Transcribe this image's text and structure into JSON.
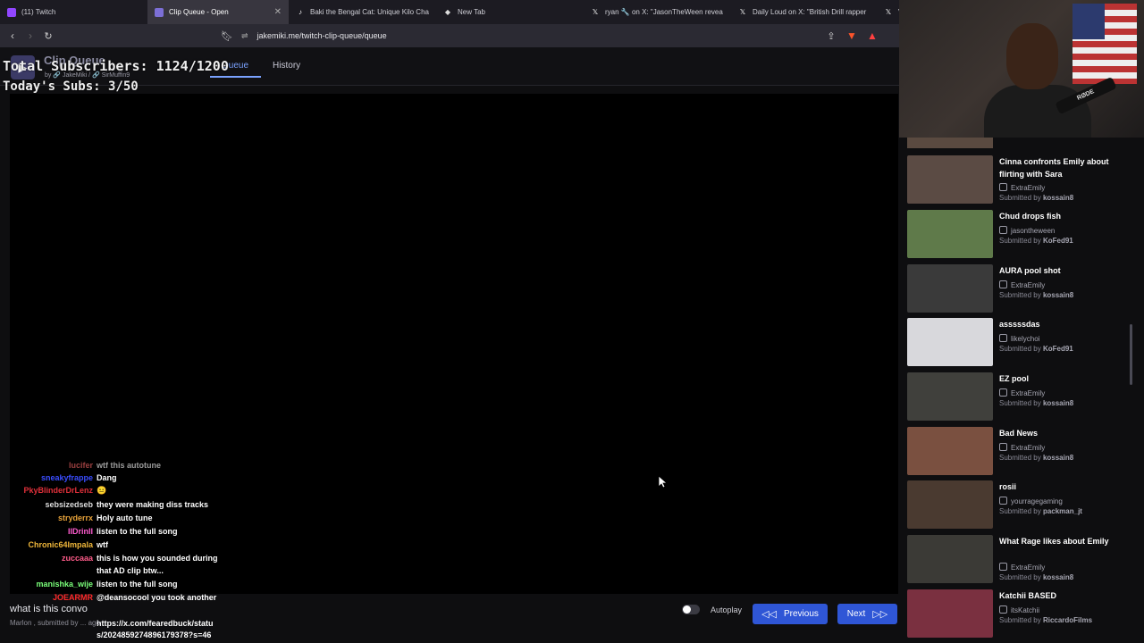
{
  "browser": {
    "tabs": [
      {
        "label": "(11) Twitch",
        "icon": "twitch-icon",
        "color": "#9146ff"
      },
      {
        "label": "Clip Queue - Open",
        "icon": "clipqueue-icon",
        "color": "#7c6fd6"
      },
      {
        "label": "Baki the Bengal Cat: Unique Kilo Cha",
        "icon": "tiktok-icon",
        "color": "#ffffff"
      },
      {
        "label": "New Tab",
        "icon": "brave-icon",
        "color": "#dddddd"
      },
      {
        "label": "ryan 🔧 on X: \"JasonTheWeen revea",
        "icon": "x-icon",
        "color": "#ffffff"
      },
      {
        "label": "Daily Loud on X: \"British Drill rapper",
        "icon": "x-icon",
        "color": "#ffffff"
      },
      {
        "label": "V",
        "icon": "x-icon",
        "color": "#ffffff"
      }
    ],
    "url": "jakemiki.me/twitch-clip-queue/queue"
  },
  "app": {
    "title": "Clip Queue",
    "by": "by 🔗 JakeMiki / 🔗 SirMuffin9",
    "nav": {
      "queue": "Queue",
      "history": "History"
    }
  },
  "overlay": {
    "total_subs": "Total Subscribers: 1124/1200",
    "today_subs": "Today's Subs: 3/50"
  },
  "chat": [
    {
      "user": "lucifer",
      "msg": "wtf this autotune",
      "color": "#ff6a6a"
    },
    {
      "user": "sneakyfrappe",
      "msg": "Dang",
      "color": "#3a4dff"
    },
    {
      "user": "PkyBlinderDrLenz",
      "msg": "😐",
      "color": "#e0303a"
    },
    {
      "user": "sebsizedseb",
      "msg": "they were making diss tracks",
      "color": "#dddddd"
    },
    {
      "user": "stryderrx",
      "msg": "Holy auto tune",
      "color": "#e8a33a"
    },
    {
      "user": "IIDrinII",
      "msg": "listen to the full song",
      "color": "#ff5ccf"
    },
    {
      "user": "Chronic64Impala",
      "msg": "wtf",
      "color": "#f0b73a"
    },
    {
      "user": "zuccaaa",
      "msg": "this is how you sounded during",
      "color": "#ff5c8a"
    },
    {
      "user": "",
      "msg": "that AD clip btw...",
      "color": "#ffffff"
    },
    {
      "user": "manishka_wije",
      "msg": "listen to the full song",
      "color": "#7aff7a"
    },
    {
      "user": "JOEARMR",
      "msg": "@deansocool you took another",
      "color": "#ff2a2a"
    },
    {
      "user": "",
      "msg": "https://x.com/fearedbuck/statu",
      "color": "#ffffff"
    },
    {
      "user": "",
      "msg": "s/2024859274896179378?s=46",
      "color": "#ffffff"
    }
  ],
  "current_clip": {
    "title": "what is this convo",
    "sub": "Marlon , submitted by ... ago"
  },
  "controls": {
    "autoplay": "Autoplay",
    "previous": "Previous",
    "next": "Next"
  },
  "queue": [
    {
      "title": "Cinna confronts Emily about flirting with Sara",
      "channel": "ExtraEmily",
      "submitter": "kossain8",
      "thumb": "#5b4b44"
    },
    {
      "title": "Chud drops fish",
      "channel": "jasontheween",
      "submitter": "KoFed91",
      "thumb": "#5f7a4a"
    },
    {
      "title": "AURA pool shot",
      "channel": "ExtraEmily",
      "submitter": "kossain8",
      "thumb": "#3a3a3a"
    },
    {
      "title": "asssssdas",
      "channel": "likelychoi",
      "submitter": "KoFed91",
      "thumb": "#d8d8dc"
    },
    {
      "title": "EZ pool",
      "channel": "ExtraEmily",
      "submitter": "kossain8",
      "thumb": "#40403c"
    },
    {
      "title": "Bad News",
      "channel": "ExtraEmily",
      "submitter": "kossain8",
      "thumb": "#7a5040"
    },
    {
      "title": "rosii",
      "channel": "yourragegaming",
      "submitter": "packman_jt",
      "thumb": "#4a3a30"
    },
    {
      "title": "What Rage likes about Emily",
      "channel": "ExtraEmily",
      "submitter": "kossain8",
      "thumb": "#3b3a36"
    },
    {
      "title": "Katchii BASED",
      "channel": "itsKatchii",
      "submitter": "RiccardoFilms",
      "thumb": "#7a3040"
    }
  ],
  "submitted_prefix": "Submitted by",
  "webcam_label": "RØDE"
}
